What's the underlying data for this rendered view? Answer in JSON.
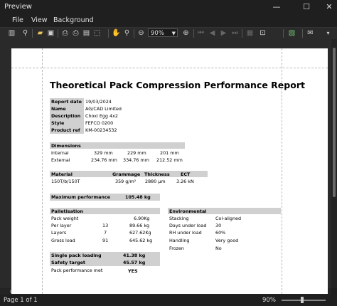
{
  "window": {
    "title": "Preview"
  },
  "menu": {
    "file": "File",
    "view": "View",
    "background": "Background"
  },
  "toolbar": {
    "zoom": "90%"
  },
  "status": {
    "page": "Page 1 of 1",
    "zoom": "90%"
  },
  "report": {
    "title": "Theoretical Pack Compression Performance Report",
    "meta": [
      {
        "label": "Report date",
        "value": "19/03/2024"
      },
      {
        "label": "Name",
        "value": "AG/CAD Limited"
      },
      {
        "label": "Description",
        "value": "Choxi Egg 4x2"
      },
      {
        "label": "Style",
        "value": "FEFCO 0200"
      },
      {
        "label": "Product ref",
        "value": "KM-00234532"
      }
    ],
    "dimensions": {
      "header": "Dimensions",
      "rows": [
        {
          "label": "Internal",
          "v1": "329 mm",
          "v2": "229 mm",
          "v3": "201 mm"
        },
        {
          "label": "External",
          "v1": "234.76 mm",
          "v2": "334.76 mm",
          "v3": "212.52 mm"
        }
      ]
    },
    "material": {
      "h_material": "Material",
      "h_grammage": "Grammage",
      "h_thickness": "Thickness",
      "h_ect": "ECT",
      "material": "150T/b/150T",
      "grammage": "359 g/m²",
      "thickness": "2880 µm",
      "ect": "3.26 kN"
    },
    "max_perf": {
      "label": "Maximum performance",
      "value": "105.48 kg"
    },
    "palletisation": {
      "header": "Palletisation",
      "pack_weight": {
        "label": "Pack weight",
        "value": "6.90Kg"
      },
      "per_layer": {
        "label": "Per layer",
        "count": "13",
        "value": "89.66 kg"
      },
      "layers": {
        "label": "Layers",
        "count": "7",
        "value": "627.62Kg"
      },
      "gross_load": {
        "label": "Gross load",
        "count": "91",
        "value": "645.62 kg"
      }
    },
    "environmental": {
      "header": "Environmental",
      "rows": [
        {
          "label": "Stacking",
          "value": "Col-aligned"
        },
        {
          "label": "Days under load",
          "value": "30"
        },
        {
          "label": "RH under load",
          "value": "60%"
        },
        {
          "label": "Handling",
          "value": "Very good"
        },
        {
          "label": "Frozen",
          "value": "No"
        }
      ]
    },
    "summary": {
      "single": {
        "label": "Single pack loading",
        "value": "41.38 kg"
      },
      "safety": {
        "label": "Safety target",
        "value": "45.57 kg"
      },
      "met": {
        "label": "Pack performance met",
        "value": "YES"
      }
    }
  }
}
